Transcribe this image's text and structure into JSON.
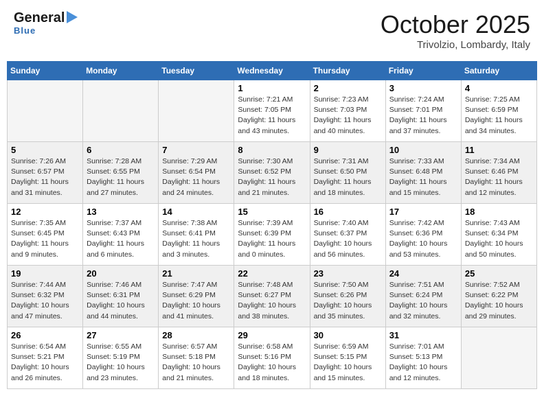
{
  "header": {
    "logo_line1": "General",
    "logo_line2": "Blue",
    "month": "October 2025",
    "location": "Trivolzio, Lombardy, Italy"
  },
  "days_of_week": [
    "Sunday",
    "Monday",
    "Tuesday",
    "Wednesday",
    "Thursday",
    "Friday",
    "Saturday"
  ],
  "weeks": [
    [
      {
        "day": "",
        "info": ""
      },
      {
        "day": "",
        "info": ""
      },
      {
        "day": "",
        "info": ""
      },
      {
        "day": "1",
        "info": "Sunrise: 7:21 AM\nSunset: 7:05 PM\nDaylight: 11 hours and 43 minutes."
      },
      {
        "day": "2",
        "info": "Sunrise: 7:23 AM\nSunset: 7:03 PM\nDaylight: 11 hours and 40 minutes."
      },
      {
        "day": "3",
        "info": "Sunrise: 7:24 AM\nSunset: 7:01 PM\nDaylight: 11 hours and 37 minutes."
      },
      {
        "day": "4",
        "info": "Sunrise: 7:25 AM\nSunset: 6:59 PM\nDaylight: 11 hours and 34 minutes."
      }
    ],
    [
      {
        "day": "5",
        "info": "Sunrise: 7:26 AM\nSunset: 6:57 PM\nDaylight: 11 hours and 31 minutes."
      },
      {
        "day": "6",
        "info": "Sunrise: 7:28 AM\nSunset: 6:55 PM\nDaylight: 11 hours and 27 minutes."
      },
      {
        "day": "7",
        "info": "Sunrise: 7:29 AM\nSunset: 6:54 PM\nDaylight: 11 hours and 24 minutes."
      },
      {
        "day": "8",
        "info": "Sunrise: 7:30 AM\nSunset: 6:52 PM\nDaylight: 11 hours and 21 minutes."
      },
      {
        "day": "9",
        "info": "Sunrise: 7:31 AM\nSunset: 6:50 PM\nDaylight: 11 hours and 18 minutes."
      },
      {
        "day": "10",
        "info": "Sunrise: 7:33 AM\nSunset: 6:48 PM\nDaylight: 11 hours and 15 minutes."
      },
      {
        "day": "11",
        "info": "Sunrise: 7:34 AM\nSunset: 6:46 PM\nDaylight: 11 hours and 12 minutes."
      }
    ],
    [
      {
        "day": "12",
        "info": "Sunrise: 7:35 AM\nSunset: 6:45 PM\nDaylight: 11 hours and 9 minutes."
      },
      {
        "day": "13",
        "info": "Sunrise: 7:37 AM\nSunset: 6:43 PM\nDaylight: 11 hours and 6 minutes."
      },
      {
        "day": "14",
        "info": "Sunrise: 7:38 AM\nSunset: 6:41 PM\nDaylight: 11 hours and 3 minutes."
      },
      {
        "day": "15",
        "info": "Sunrise: 7:39 AM\nSunset: 6:39 PM\nDaylight: 11 hours and 0 minutes."
      },
      {
        "day": "16",
        "info": "Sunrise: 7:40 AM\nSunset: 6:37 PM\nDaylight: 10 hours and 56 minutes."
      },
      {
        "day": "17",
        "info": "Sunrise: 7:42 AM\nSunset: 6:36 PM\nDaylight: 10 hours and 53 minutes."
      },
      {
        "day": "18",
        "info": "Sunrise: 7:43 AM\nSunset: 6:34 PM\nDaylight: 10 hours and 50 minutes."
      }
    ],
    [
      {
        "day": "19",
        "info": "Sunrise: 7:44 AM\nSunset: 6:32 PM\nDaylight: 10 hours and 47 minutes."
      },
      {
        "day": "20",
        "info": "Sunrise: 7:46 AM\nSunset: 6:31 PM\nDaylight: 10 hours and 44 minutes."
      },
      {
        "day": "21",
        "info": "Sunrise: 7:47 AM\nSunset: 6:29 PM\nDaylight: 10 hours and 41 minutes."
      },
      {
        "day": "22",
        "info": "Sunrise: 7:48 AM\nSunset: 6:27 PM\nDaylight: 10 hours and 38 minutes."
      },
      {
        "day": "23",
        "info": "Sunrise: 7:50 AM\nSunset: 6:26 PM\nDaylight: 10 hours and 35 minutes."
      },
      {
        "day": "24",
        "info": "Sunrise: 7:51 AM\nSunset: 6:24 PM\nDaylight: 10 hours and 32 minutes."
      },
      {
        "day": "25",
        "info": "Sunrise: 7:52 AM\nSunset: 6:22 PM\nDaylight: 10 hours and 29 minutes."
      }
    ],
    [
      {
        "day": "26",
        "info": "Sunrise: 6:54 AM\nSunset: 5:21 PM\nDaylight: 10 hours and 26 minutes."
      },
      {
        "day": "27",
        "info": "Sunrise: 6:55 AM\nSunset: 5:19 PM\nDaylight: 10 hours and 23 minutes."
      },
      {
        "day": "28",
        "info": "Sunrise: 6:57 AM\nSunset: 5:18 PM\nDaylight: 10 hours and 21 minutes."
      },
      {
        "day": "29",
        "info": "Sunrise: 6:58 AM\nSunset: 5:16 PM\nDaylight: 10 hours and 18 minutes."
      },
      {
        "day": "30",
        "info": "Sunrise: 6:59 AM\nSunset: 5:15 PM\nDaylight: 10 hours and 15 minutes."
      },
      {
        "day": "31",
        "info": "Sunrise: 7:01 AM\nSunset: 5:13 PM\nDaylight: 10 hours and 12 minutes."
      },
      {
        "day": "",
        "info": ""
      }
    ]
  ]
}
